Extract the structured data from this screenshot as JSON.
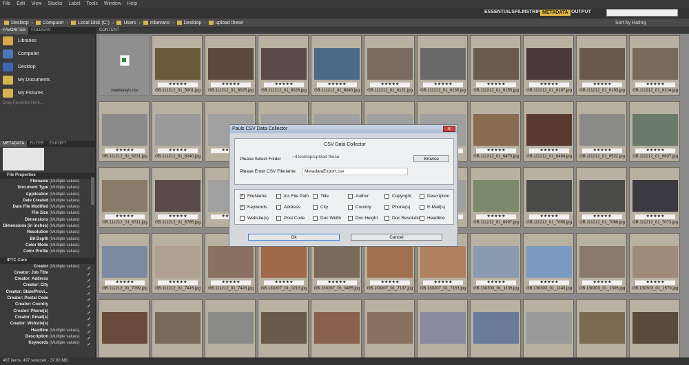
{
  "menu": [
    "File",
    "Edit",
    "View",
    "Stacks",
    "Label",
    "Tools",
    "Window",
    "Help"
  ],
  "workspaces": {
    "essentials": "ESSENTIALS",
    "filmstrip": "FILMSTRIP",
    "metadata": "METADATA",
    "output": "OUTPUT"
  },
  "search_placeholder": "",
  "path": [
    "Desktop",
    "Computer",
    "Local Disk (C:)",
    "Users",
    "mbevans",
    "Desktop",
    "upload these"
  ],
  "sort_label": "Sort by Rating",
  "left": {
    "tabs": [
      "FAVORITES",
      "FOLDERS"
    ],
    "favorites": [
      {
        "label": "Libraries",
        "color": "#d9a84a"
      },
      {
        "label": "Computer",
        "color": "#4a78b8"
      },
      {
        "label": "Desktop",
        "color": "#3a66b0"
      },
      {
        "label": "My Documents",
        "color": "#d8b450"
      },
      {
        "label": "My Pictures",
        "color": "#d8b450"
      }
    ],
    "drag_hint": "Drag Favorites Here...",
    "meta_tabs": [
      "METADATA",
      "FILTER",
      "EXPORT"
    ],
    "file_properties_title": "File Properties",
    "file_properties": [
      {
        "k": "Filename",
        "v": "(Multiple values)"
      },
      {
        "k": "Document Type",
        "v": "(Multiple values)"
      },
      {
        "k": "Application",
        "v": "(Multiple values)"
      },
      {
        "k": "Date Created",
        "v": "(Multiple values)"
      },
      {
        "k": "Date File Modified",
        "v": "(Multiple values)"
      },
      {
        "k": "File Size",
        "v": "(Multiple values)"
      },
      {
        "k": "Dimensions",
        "v": "(Multiple values)"
      },
      {
        "k": "Dimensions (in inches)",
        "v": "(Multiple values)"
      },
      {
        "k": "Resolution",
        "v": "(Multiple values)"
      },
      {
        "k": "Bit Depth",
        "v": "(Multiple values)"
      },
      {
        "k": "Color Mode",
        "v": "(Multiple values)"
      },
      {
        "k": "Color Profile",
        "v": "(Multiple values)"
      }
    ],
    "iptc_title": "IPTC Core",
    "iptc": [
      {
        "k": "Creator",
        "v": "(Multiple values)"
      },
      {
        "k": "Creator: Job Title",
        "v": ""
      },
      {
        "k": "Creator: Address",
        "v": ""
      },
      {
        "k": "Creator: City",
        "v": ""
      },
      {
        "k": "Creator: State/Provi...",
        "v": ""
      },
      {
        "k": "Creator: Postal Code",
        "v": ""
      },
      {
        "k": "Creator: Country",
        "v": ""
      },
      {
        "k": "Creator: Phone(s)",
        "v": ""
      },
      {
        "k": "Creator: Email(s)",
        "v": ""
      },
      {
        "k": "Creator: Website(s)",
        "v": ""
      },
      {
        "k": "Headline",
        "v": "(Multiple values)"
      },
      {
        "k": "Description",
        "v": "(Multiple values)"
      },
      {
        "k": "Keywords",
        "v": "(Multiple values)"
      }
    ]
  },
  "content_header": "CONTENT",
  "thumbnails": [
    [
      {
        "f": "needskeys.csv",
        "c": "#888",
        "csv": true
      },
      {
        "f": "GB.111212_01_5901.jpg",
        "c": "#6b5a3a"
      },
      {
        "f": "GB.111212_01_6025.jpg",
        "c": "#5c4a40"
      },
      {
        "f": "GB.111212_01_6028.jpg",
        "c": "#5a4a48"
      },
      {
        "f": "GB.111212_01_6043.jpg",
        "c": "#4a6a8a"
      },
      {
        "f": "GB.111212_01_6121.jpg",
        "c": "#7a6a60"
      },
      {
        "f": "GB.111212_01_6130.jpg",
        "c": "#6a6a6a"
      },
      {
        "f": "GB.111212_01_6155.jpg",
        "c": "#6a5a50"
      },
      {
        "f": "GB.111212_01_6187.jpg",
        "c": "#4a3a38"
      },
      {
        "f": "GB.111212_01_6193.jpg",
        "c": "#6a5a4a"
      },
      {
        "f": "GB.111212_01_6214.jpg",
        "c": "#7a6a5a"
      }
    ],
    [
      {
        "f": "GB.111212_01_6231.jpg",
        "c": "#8a8a8a"
      },
      {
        "f": "GB.111212_01_6240.jpg",
        "c": "#9a9a9a"
      },
      {
        "f": "",
        "c": "#a0a0a0"
      },
      {
        "f": "",
        "c": "#a0a0a0"
      },
      {
        "f": "",
        "c": "#a0a0a0"
      },
      {
        "f": "",
        "c": "#a0a0a0"
      },
      {
        "f": "",
        "c": "#a0a0a0"
      },
      {
        "f": "GB.111212_01_6470.jpg",
        "c": "#8a6a50"
      },
      {
        "f": "GB.111212_01_6484.jpg",
        "c": "#5a3a30"
      },
      {
        "f": "GB.111212_01_6522.jpg",
        "c": "#8a8a88"
      },
      {
        "f": "GB.111212_01_6637.jpg",
        "c": "#6a7a6a"
      }
    ],
    [
      {
        "f": "GB.111212_01_6711.jpg",
        "c": "#8a7a6a"
      },
      {
        "f": "GB.111212_01_6785.jpg",
        "c": "#5a4a48"
      },
      {
        "f": "",
        "c": "#a0a0a0"
      },
      {
        "f": "",
        "c": "#a0a0a0"
      },
      {
        "f": "",
        "c": "#a0a0a0"
      },
      {
        "f": "",
        "c": "#a0a0a0"
      },
      {
        "f": "",
        "c": "#a0a0a0"
      },
      {
        "f": "GB.111212_01_6997.jpg",
        "c": "#7a8a6a"
      },
      {
        "f": "GB.111212_01_7058.jpg",
        "c": "#4a4a48"
      },
      {
        "f": "GB.111212_01_7068.jpg",
        "c": "#4a4a48"
      },
      {
        "f": "GB.111212_01_7073.jpg",
        "c": "#3a3a40"
      }
    ],
    [
      {
        "f": "GB.111212_01_7099.jpg",
        "c": "#7a8aa0"
      },
      {
        "f": "GB.111212_01_7416.jpg",
        "c": "#b0a090"
      },
      {
        "f": "GB.111212_01_7428.jpg",
        "c": "#8a7060"
      },
      {
        "f": "GB.130207_01_0213.jpg",
        "c": "#a06a4a"
      },
      {
        "f": "GB.130207_01_0465.jpg",
        "c": "#7a6a5a"
      },
      {
        "f": "GB.130207_01_7137.jpg",
        "c": "#a07050"
      },
      {
        "f": "GB.130207_01_7163.jpg",
        "c": "#b08060"
      },
      {
        "f": "GB.130303_01_1136.jpg",
        "c": "#8a9ab0"
      },
      {
        "f": "GB.130303_01_1143.jpg",
        "c": "#7a9ac0"
      },
      {
        "f": "GB.130303_01_1306.jpg",
        "c": "#8a7a6a"
      },
      {
        "f": "GB.130303_01_1579.jpg",
        "c": "#a08a7a"
      }
    ],
    [
      {
        "f": "",
        "c": "#6a4a3a"
      },
      {
        "f": "",
        "c": "#7a6a5a"
      },
      {
        "f": "",
        "c": "#8a8a88"
      },
      {
        "f": "",
        "c": "#6a5a4a"
      },
      {
        "f": "",
        "c": "#8a6050"
      },
      {
        "f": "",
        "c": "#8a7060"
      },
      {
        "f": "",
        "c": "#8a8aa0"
      },
      {
        "f": "",
        "c": "#6a7a9a"
      },
      {
        "f": "",
        "c": "#9a9a9a"
      },
      {
        "f": "",
        "c": "#7a6a50"
      },
      {
        "f": "",
        "c": "#5a4a3a"
      }
    ]
  ],
  "stars": "★★★★★",
  "dialog": {
    "title": "Pauls CSV Data Collector",
    "close": "x",
    "heading": "CSV Data Collector",
    "folder_label": "Please Select Folder",
    "folder_value": "~/Desktop/upload these",
    "browse": "Browse",
    "filename_label": "Please Enter CSV Filename",
    "filename_value": "MetadataExport.csv",
    "checkboxes": [
      [
        {
          "label": "FileName",
          "checked": true
        },
        {
          "label": "Inc File Path",
          "checked": false
        },
        {
          "label": "Title",
          "checked": false
        },
        {
          "label": "Author",
          "checked": false
        },
        {
          "label": "Copyright",
          "checked": false
        },
        {
          "label": "Description",
          "checked": false
        }
      ],
      [
        {
          "label": "Keywords",
          "checked": true
        },
        {
          "label": "Address",
          "checked": false
        },
        {
          "label": "City",
          "checked": false
        },
        {
          "label": "Country",
          "checked": false
        },
        {
          "label": "Phone(s)",
          "checked": false
        },
        {
          "label": "E-Mail(s)",
          "checked": false
        }
      ],
      [
        {
          "label": "Website(s)",
          "checked": false
        },
        {
          "label": "Post Code",
          "checked": false
        },
        {
          "label": "Doc Width",
          "checked": false
        },
        {
          "label": "Doc Height",
          "checked": false
        },
        {
          "label": "Doc Resolution",
          "checked": false
        },
        {
          "label": "Headline",
          "checked": false
        }
      ]
    ],
    "ok": "Ok",
    "cancel": "Cancel"
  },
  "status": "497 items, 497 selected - 37.80 MB"
}
